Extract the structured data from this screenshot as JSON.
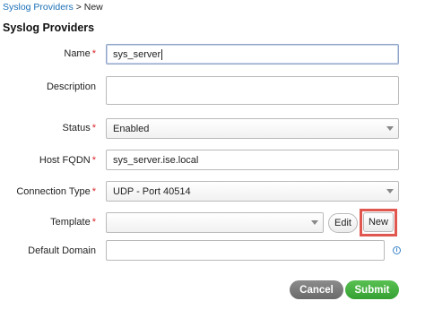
{
  "breadcrumb": {
    "parent": "Syslog Providers",
    "separator": " > ",
    "current": "New"
  },
  "page_title": "Syslog Providers",
  "form": {
    "name": {
      "label": "Name",
      "value": "sys_server",
      "required": true
    },
    "description": {
      "label": "Description",
      "value": ""
    },
    "status": {
      "label": "Status",
      "value": "Enabled",
      "required": true
    },
    "host_fqdn": {
      "label": "Host FQDN",
      "value": "sys_server.ise.local",
      "required": true
    },
    "connection_type": {
      "label": "Connection Type",
      "value": "UDP - Port 40514",
      "required": true
    },
    "template": {
      "label": "Template",
      "value": "",
      "required": true,
      "edit_label": "Edit",
      "new_label": "New"
    },
    "default_domain": {
      "label": "Default Domain",
      "value": ""
    }
  },
  "required_mark": "*",
  "actions": {
    "cancel_label": "Cancel",
    "submit_label": "Submit"
  },
  "colors": {
    "link": "#1a6fb5",
    "required": "#d9262c",
    "submit": "#3aa935",
    "cancel": "#7a7a7a",
    "highlight": "#e0574f"
  }
}
